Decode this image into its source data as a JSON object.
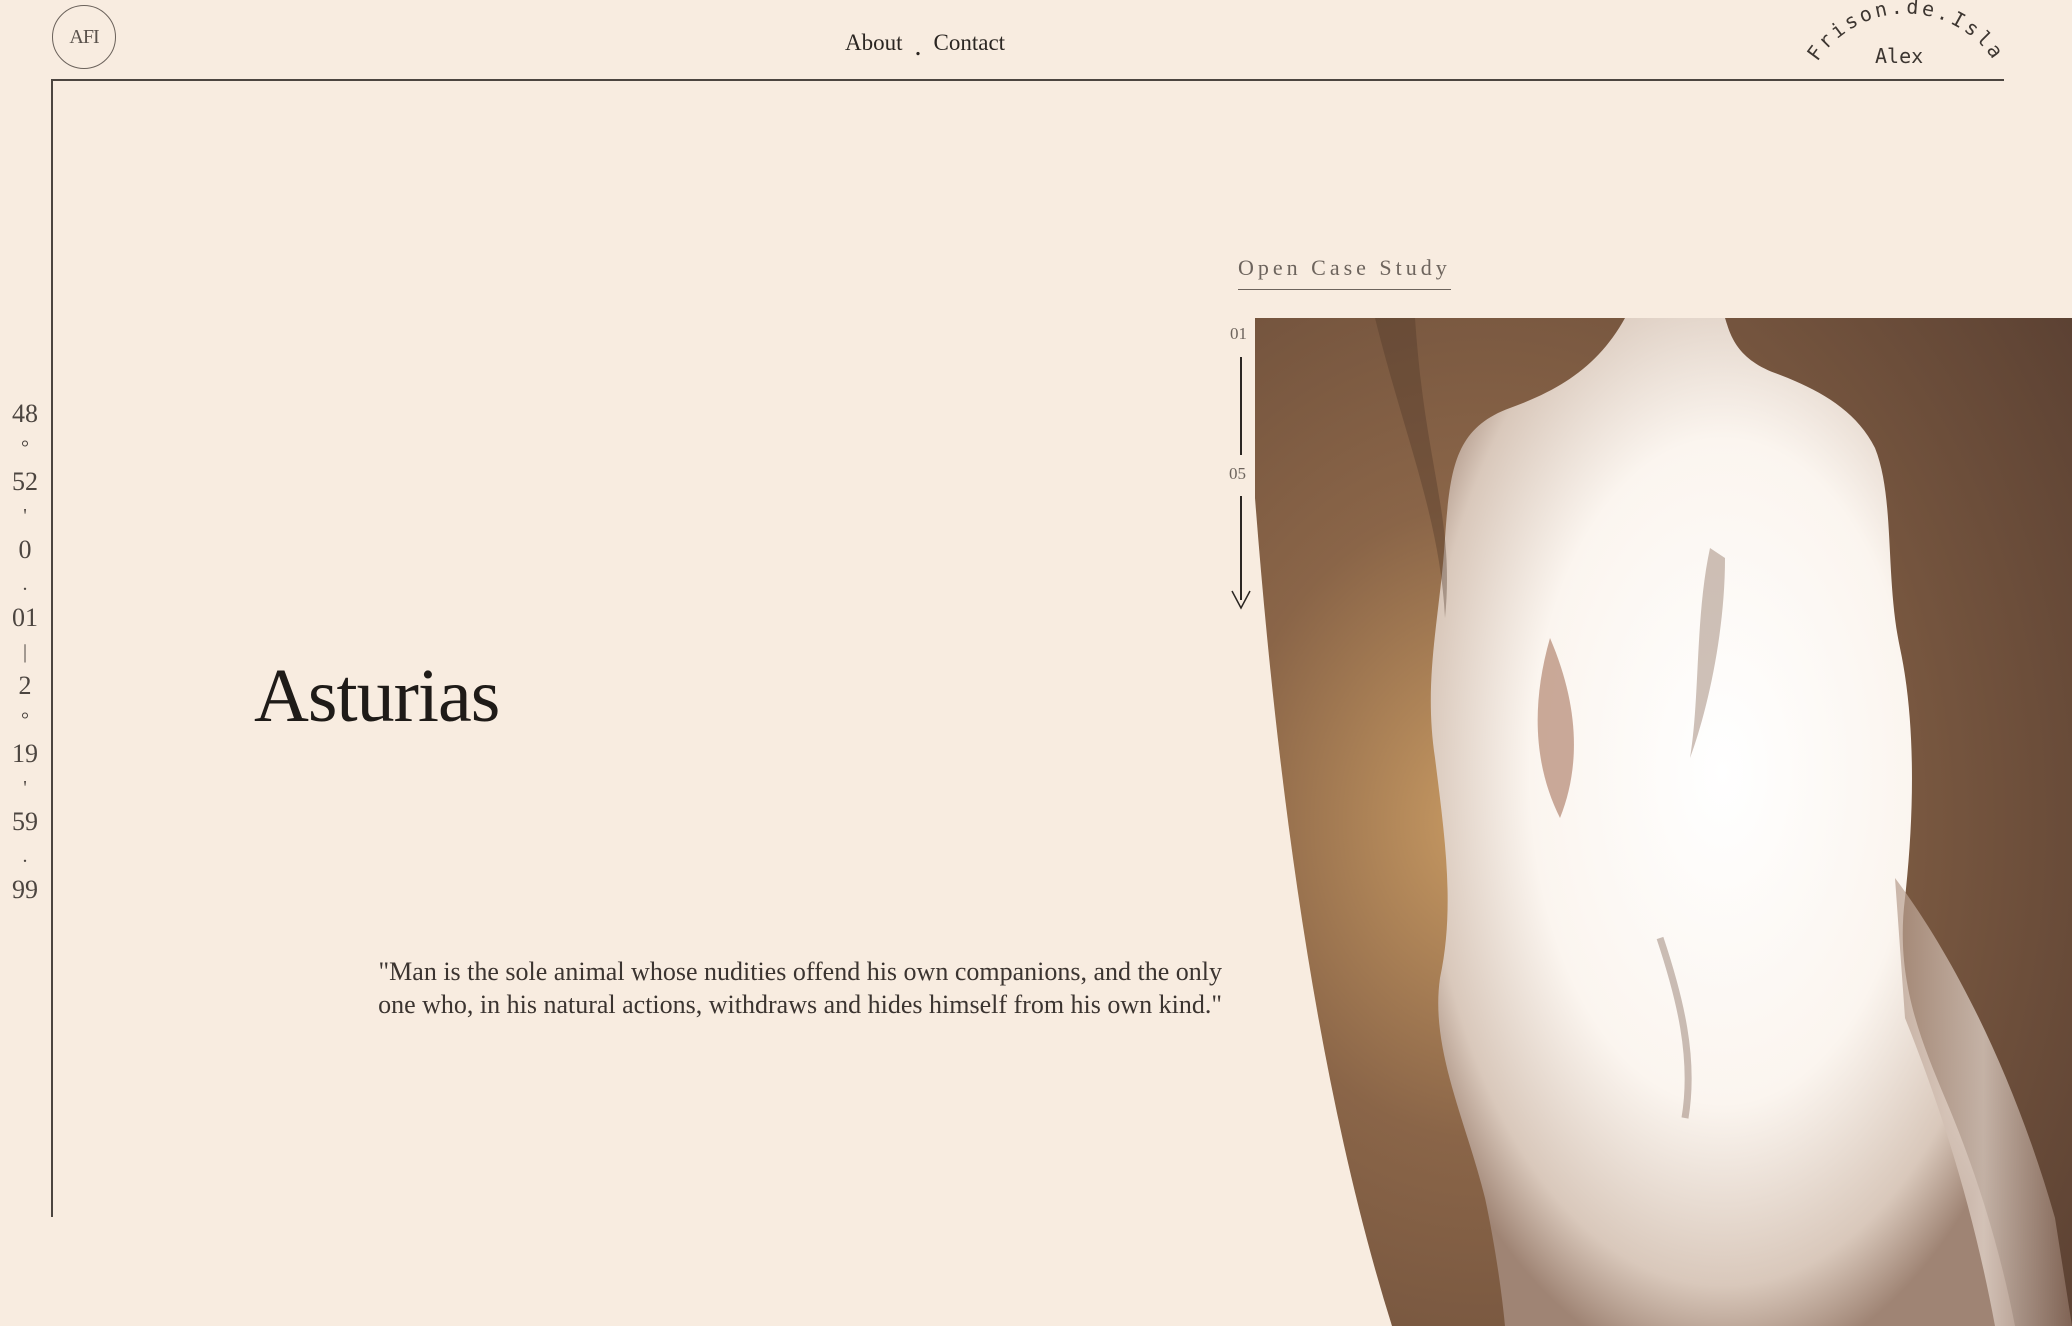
{
  "logo": {
    "text": "AFI"
  },
  "nav": {
    "about": "About",
    "separator": ".",
    "contact": "Contact"
  },
  "brand": {
    "arc_text": "Frison.de.Isla",
    "name": "Alex"
  },
  "coordinates": {
    "items": [
      {
        "num": "48",
        "sep": "°"
      },
      {
        "num": "52",
        "sep": "'"
      },
      {
        "num": "0",
        "sep": "."
      },
      {
        "num": "01",
        "sep": "|"
      },
      {
        "num": "2",
        "sep": "°"
      },
      {
        "num": "19",
        "sep": "'"
      },
      {
        "num": "59",
        "sep": "."
      },
      {
        "num": "99",
        "sep": ""
      }
    ]
  },
  "hero": {
    "title": "Asturias",
    "quote_line1": "\"Man is the sole animal whose nudities offend his own companions, and the only",
    "quote_line2": "one who, in his natural actions, withdraws and hides himself from his own kind.\""
  },
  "case_study": {
    "button_label": "Open Case Study"
  },
  "slider": {
    "current": "01",
    "total": "05"
  },
  "colors": {
    "background": "#f8ece0",
    "ink": "#2b2622",
    "muted": "#6d645d",
    "art_dark": "#5a4032",
    "art_light": "#fbf5ef"
  }
}
